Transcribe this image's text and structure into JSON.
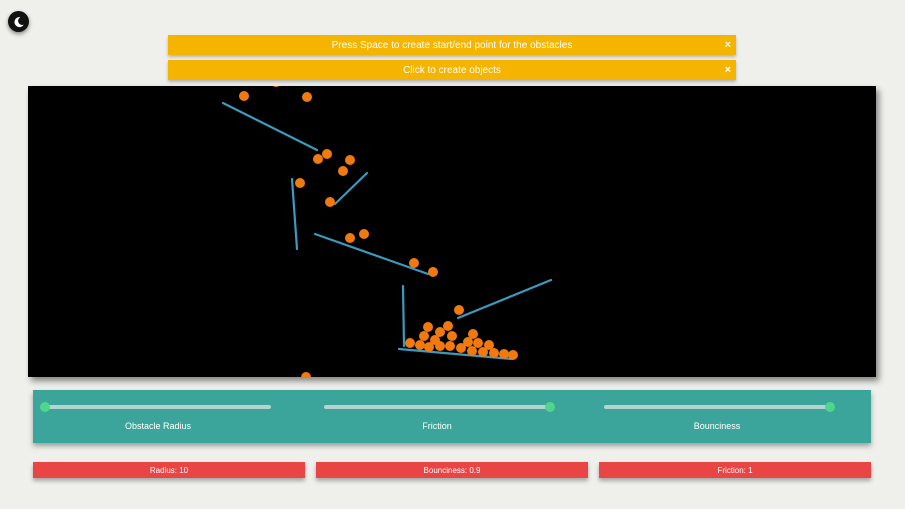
{
  "theme": {
    "icon": "moon-icon"
  },
  "toasts": [
    {
      "text": "Press Space to create start/end point for the obstacles",
      "close": "×"
    },
    {
      "text": "Click to create objects",
      "close": "×"
    }
  ],
  "sliders": [
    {
      "label": "Obstacle Radius",
      "value": 0.0
    },
    {
      "label": "Friction",
      "value": 1.0
    },
    {
      "label": "Bounciness",
      "value": 1.0
    }
  ],
  "status": {
    "radius": "Radius: 10",
    "bounciness": "Bounciness: 0.9",
    "friction": "Friction: 1"
  },
  "colors": {
    "background": "#efefeb",
    "toast": "#f5b400",
    "canvas": "#000000",
    "obstacle": "#3a9bbf",
    "ball": "#f07a10",
    "controls": "#3ba59c",
    "slider_thumb": "#4fd68a",
    "status": "#ea4545"
  }
}
